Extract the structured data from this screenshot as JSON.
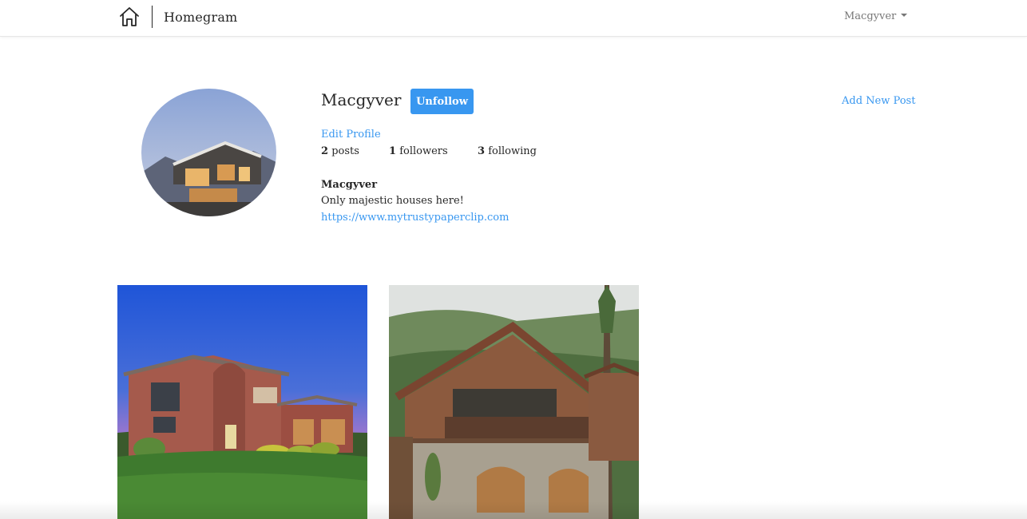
{
  "navbar": {
    "brand": "Homegram",
    "user_menu_label": "Macgyver",
    "home_icon": "home-icon",
    "caret_icon": "caret-down-icon"
  },
  "profile": {
    "username": "Macgyver",
    "follow_button_label": "Unfollow",
    "add_post_label": "Add New Post",
    "edit_profile_label": "Edit Profile",
    "stats": {
      "posts_count": "2",
      "posts_label": "posts",
      "followers_count": "1",
      "followers_label": "followers",
      "following_count": "3",
      "following_label": "following"
    },
    "bio": {
      "name": "Macgyver",
      "text": "Only majestic houses here!",
      "link": "https://www.mytrustypaperclip.com"
    }
  },
  "colors": {
    "accent": "#3897f0",
    "text": "#262626",
    "muted": "#777777"
  }
}
